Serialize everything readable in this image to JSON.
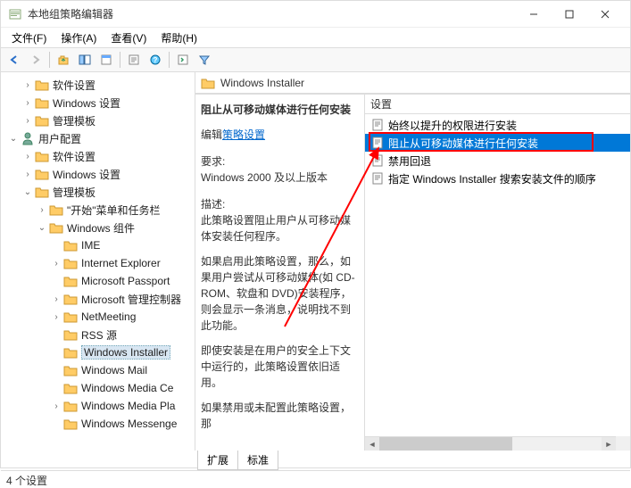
{
  "window": {
    "title": "本地组策略编辑器"
  },
  "menu": {
    "file": "文件(F)",
    "action": "操作(A)",
    "view": "查看(V)",
    "help": "帮助(H)"
  },
  "tree": {
    "items": [
      {
        "label": "软件设置",
        "indent": 24,
        "toggle": "›",
        "icon": "folder"
      },
      {
        "label": "Windows 设置",
        "indent": 24,
        "toggle": "›",
        "icon": "folder"
      },
      {
        "label": "管理模板",
        "indent": 24,
        "toggle": "›",
        "icon": "folder"
      },
      {
        "label": "用户配置",
        "indent": 8,
        "toggle": "⌄",
        "icon": "user"
      },
      {
        "label": "软件设置",
        "indent": 24,
        "toggle": "›",
        "icon": "folder"
      },
      {
        "label": "Windows 设置",
        "indent": 24,
        "toggle": "›",
        "icon": "folder"
      },
      {
        "label": "管理模板",
        "indent": 24,
        "toggle": "⌄",
        "icon": "folder"
      },
      {
        "label": "\"开始\"菜单和任务栏",
        "indent": 40,
        "toggle": "›",
        "icon": "folder"
      },
      {
        "label": "Windows 组件",
        "indent": 40,
        "toggle": "⌄",
        "icon": "folder"
      },
      {
        "label": "IME",
        "indent": 56,
        "toggle": "",
        "icon": "folder"
      },
      {
        "label": "Internet Explorer",
        "indent": 56,
        "toggle": "›",
        "icon": "folder"
      },
      {
        "label": "Microsoft Passport",
        "indent": 56,
        "toggle": "",
        "icon": "folder"
      },
      {
        "label": "Microsoft 管理控制器",
        "indent": 56,
        "toggle": "›",
        "icon": "folder"
      },
      {
        "label": "NetMeeting",
        "indent": 56,
        "toggle": "›",
        "icon": "folder"
      },
      {
        "label": "RSS 源",
        "indent": 56,
        "toggle": "",
        "icon": "folder"
      },
      {
        "label": "Windows Installer",
        "indent": 56,
        "toggle": "",
        "icon": "folder",
        "selected": true
      },
      {
        "label": "Windows Mail",
        "indent": 56,
        "toggle": "",
        "icon": "folder"
      },
      {
        "label": "Windows Media Ce",
        "indent": 56,
        "toggle": "",
        "icon": "folder"
      },
      {
        "label": "Windows Media Pla",
        "indent": 56,
        "toggle": "›",
        "icon": "folder"
      },
      {
        "label": "Windows Messenge",
        "indent": 56,
        "toggle": "",
        "icon": "folder"
      }
    ]
  },
  "header": {
    "title": "Windows Installer"
  },
  "details": {
    "title": "阻止从可移动媒体进行任何安装",
    "edit_prefix": "编辑",
    "edit_link": "策略设置",
    "req_label": "要求:",
    "req_value": "Windows 2000 及以上版本",
    "desc_label": "描述:",
    "desc_p1": "此策略设置阻止用户从可移动媒体安装任何程序。",
    "desc_p2": "如果启用此策略设置，那么，如果用户尝试从可移动媒体(如 CD-ROM、软盘和 DVD)安装程序，则会显示一条消息，说明找不到此功能。",
    "desc_p3": "即使安装是在用户的安全上下文中运行的，此策略设置依旧适用。",
    "desc_p4": "如果禁用或未配置此策略设置，那"
  },
  "list": {
    "col": "设置",
    "items": [
      {
        "label": "始终以提升的权限进行安装"
      },
      {
        "label": "阻止从可移动媒体进行任何安装",
        "selected": true
      },
      {
        "label": "禁用回退"
      },
      {
        "label": "指定 Windows Installer 搜索安装文件的顺序"
      }
    ]
  },
  "tabs": {
    "extended": "扩展",
    "standard": "标准"
  },
  "status": {
    "text": "4 个设置"
  }
}
